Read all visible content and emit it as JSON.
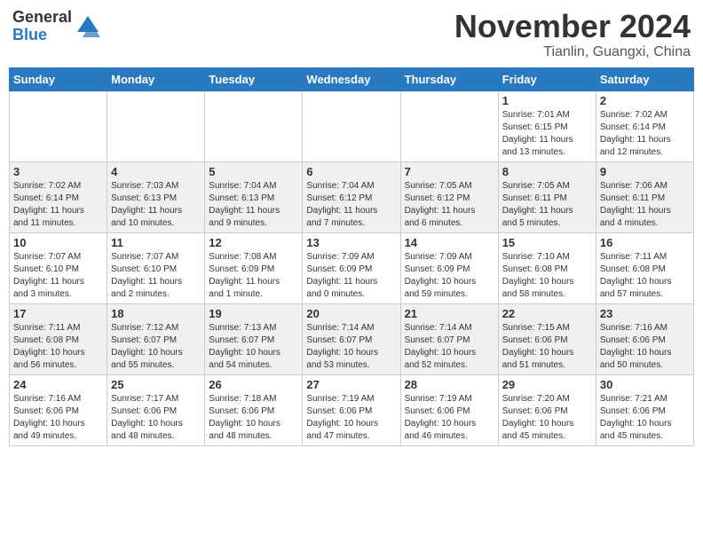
{
  "header": {
    "logo_general": "General",
    "logo_blue": "Blue",
    "month": "November 2024",
    "location": "Tianlin, Guangxi, China"
  },
  "weekdays": [
    "Sunday",
    "Monday",
    "Tuesday",
    "Wednesday",
    "Thursday",
    "Friday",
    "Saturday"
  ],
  "weeks": [
    [
      {
        "day": "",
        "info": ""
      },
      {
        "day": "",
        "info": ""
      },
      {
        "day": "",
        "info": ""
      },
      {
        "day": "",
        "info": ""
      },
      {
        "day": "",
        "info": ""
      },
      {
        "day": "1",
        "info": "Sunrise: 7:01 AM\nSunset: 6:15 PM\nDaylight: 11 hours\nand 13 minutes."
      },
      {
        "day": "2",
        "info": "Sunrise: 7:02 AM\nSunset: 6:14 PM\nDaylight: 11 hours\nand 12 minutes."
      }
    ],
    [
      {
        "day": "3",
        "info": "Sunrise: 7:02 AM\nSunset: 6:14 PM\nDaylight: 11 hours\nand 11 minutes."
      },
      {
        "day": "4",
        "info": "Sunrise: 7:03 AM\nSunset: 6:13 PM\nDaylight: 11 hours\nand 10 minutes."
      },
      {
        "day": "5",
        "info": "Sunrise: 7:04 AM\nSunset: 6:13 PM\nDaylight: 11 hours\nand 9 minutes."
      },
      {
        "day": "6",
        "info": "Sunrise: 7:04 AM\nSunset: 6:12 PM\nDaylight: 11 hours\nand 7 minutes."
      },
      {
        "day": "7",
        "info": "Sunrise: 7:05 AM\nSunset: 6:12 PM\nDaylight: 11 hours\nand 6 minutes."
      },
      {
        "day": "8",
        "info": "Sunrise: 7:05 AM\nSunset: 6:11 PM\nDaylight: 11 hours\nand 5 minutes."
      },
      {
        "day": "9",
        "info": "Sunrise: 7:06 AM\nSunset: 6:11 PM\nDaylight: 11 hours\nand 4 minutes."
      }
    ],
    [
      {
        "day": "10",
        "info": "Sunrise: 7:07 AM\nSunset: 6:10 PM\nDaylight: 11 hours\nand 3 minutes."
      },
      {
        "day": "11",
        "info": "Sunrise: 7:07 AM\nSunset: 6:10 PM\nDaylight: 11 hours\nand 2 minutes."
      },
      {
        "day": "12",
        "info": "Sunrise: 7:08 AM\nSunset: 6:09 PM\nDaylight: 11 hours\nand 1 minute."
      },
      {
        "day": "13",
        "info": "Sunrise: 7:09 AM\nSunset: 6:09 PM\nDaylight: 11 hours\nand 0 minutes."
      },
      {
        "day": "14",
        "info": "Sunrise: 7:09 AM\nSunset: 6:09 PM\nDaylight: 10 hours\nand 59 minutes."
      },
      {
        "day": "15",
        "info": "Sunrise: 7:10 AM\nSunset: 6:08 PM\nDaylight: 10 hours\nand 58 minutes."
      },
      {
        "day": "16",
        "info": "Sunrise: 7:11 AM\nSunset: 6:08 PM\nDaylight: 10 hours\nand 57 minutes."
      }
    ],
    [
      {
        "day": "17",
        "info": "Sunrise: 7:11 AM\nSunset: 6:08 PM\nDaylight: 10 hours\nand 56 minutes."
      },
      {
        "day": "18",
        "info": "Sunrise: 7:12 AM\nSunset: 6:07 PM\nDaylight: 10 hours\nand 55 minutes."
      },
      {
        "day": "19",
        "info": "Sunrise: 7:13 AM\nSunset: 6:07 PM\nDaylight: 10 hours\nand 54 minutes."
      },
      {
        "day": "20",
        "info": "Sunrise: 7:14 AM\nSunset: 6:07 PM\nDaylight: 10 hours\nand 53 minutes."
      },
      {
        "day": "21",
        "info": "Sunrise: 7:14 AM\nSunset: 6:07 PM\nDaylight: 10 hours\nand 52 minutes."
      },
      {
        "day": "22",
        "info": "Sunrise: 7:15 AM\nSunset: 6:06 PM\nDaylight: 10 hours\nand 51 minutes."
      },
      {
        "day": "23",
        "info": "Sunrise: 7:16 AM\nSunset: 6:06 PM\nDaylight: 10 hours\nand 50 minutes."
      }
    ],
    [
      {
        "day": "24",
        "info": "Sunrise: 7:16 AM\nSunset: 6:06 PM\nDaylight: 10 hours\nand 49 minutes."
      },
      {
        "day": "25",
        "info": "Sunrise: 7:17 AM\nSunset: 6:06 PM\nDaylight: 10 hours\nand 48 minutes."
      },
      {
        "day": "26",
        "info": "Sunrise: 7:18 AM\nSunset: 6:06 PM\nDaylight: 10 hours\nand 48 minutes."
      },
      {
        "day": "27",
        "info": "Sunrise: 7:19 AM\nSunset: 6:06 PM\nDaylight: 10 hours\nand 47 minutes."
      },
      {
        "day": "28",
        "info": "Sunrise: 7:19 AM\nSunset: 6:06 PM\nDaylight: 10 hours\nand 46 minutes."
      },
      {
        "day": "29",
        "info": "Sunrise: 7:20 AM\nSunset: 6:06 PM\nDaylight: 10 hours\nand 45 minutes."
      },
      {
        "day": "30",
        "info": "Sunrise: 7:21 AM\nSunset: 6:06 PM\nDaylight: 10 hours\nand 45 minutes."
      }
    ]
  ]
}
